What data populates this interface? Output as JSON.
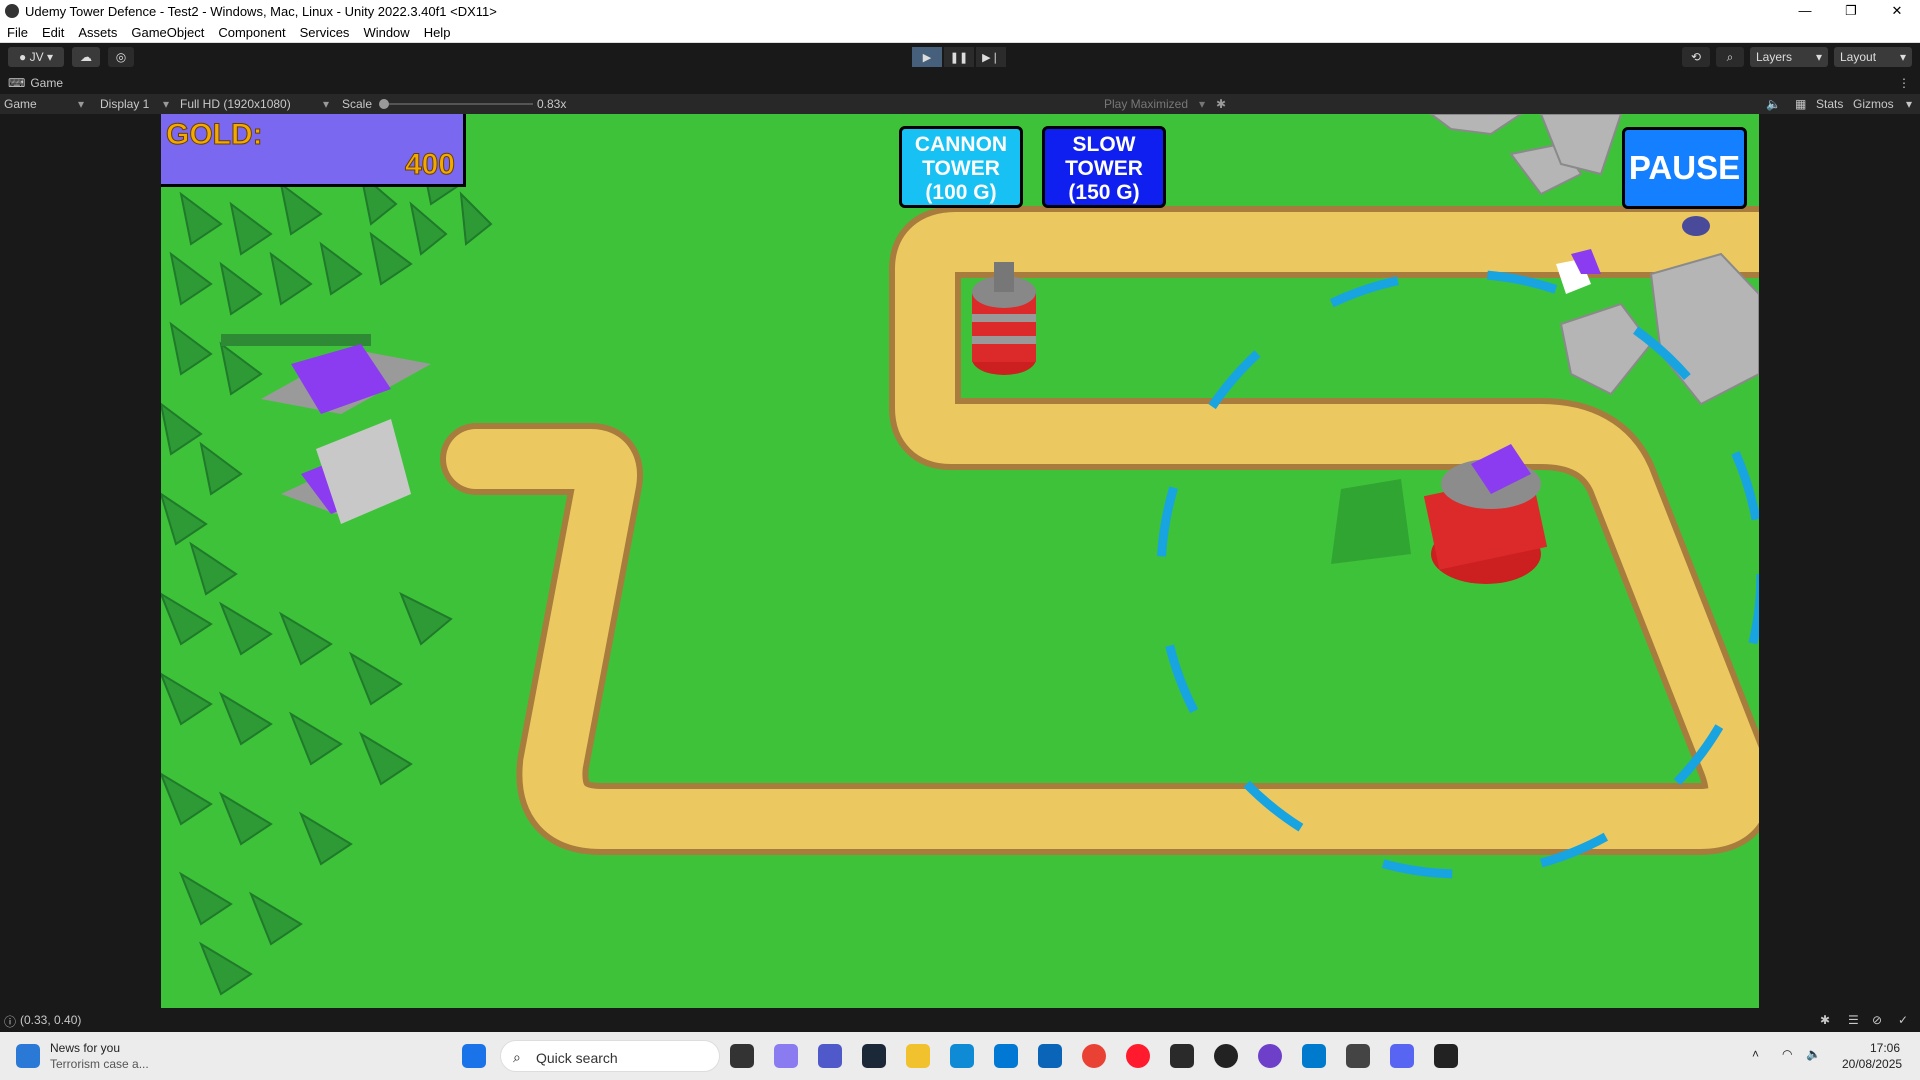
{
  "window": {
    "title": "Udemy Tower Defence - Test2 - Windows, Mac, Linux - Unity 2022.3.40f1 <DX11>",
    "controls": [
      "—",
      "❐",
      "✕"
    ]
  },
  "menu": [
    "File",
    "Edit",
    "Assets",
    "GameObject",
    "Component",
    "Services",
    "Window",
    "Help"
  ],
  "toolbar": {
    "account": "JV",
    "layers": "Layers",
    "layout": "Layout"
  },
  "tab": {
    "label": "Game"
  },
  "game_toolbar": {
    "view": "Game",
    "display": "Display 1",
    "resolution": "Full HD (1920x1080)",
    "scale_label": "Scale",
    "scale_value": "0.83x",
    "play_maximized": "Play Maximized",
    "stats": "Stats",
    "gizmos": "Gizmos"
  },
  "hud": {
    "gold_label": "GOLD:",
    "gold_value": "400",
    "cannon_tower": "CANNON\nTOWER\n(100 G)",
    "slow_tower": "SLOW\nTOWER\n(150 G)",
    "pause": "PAUSE"
  },
  "colors": {
    "grass": "#3ec23a",
    "path": "#ecc960",
    "cannon_button": "#17c1f3",
    "slow_button": "#0f1ff0",
    "pause_button": "#1580ff",
    "gold_box": "#7b68f0",
    "gold_text": "#f2a900"
  },
  "status": {
    "coords": "(0.33, 0.40)"
  },
  "taskbar": {
    "news_title": "News for you",
    "news_sub": "Terrorism case a...",
    "search": "Quick search",
    "time": "17:06",
    "date": "20/08/2025"
  }
}
